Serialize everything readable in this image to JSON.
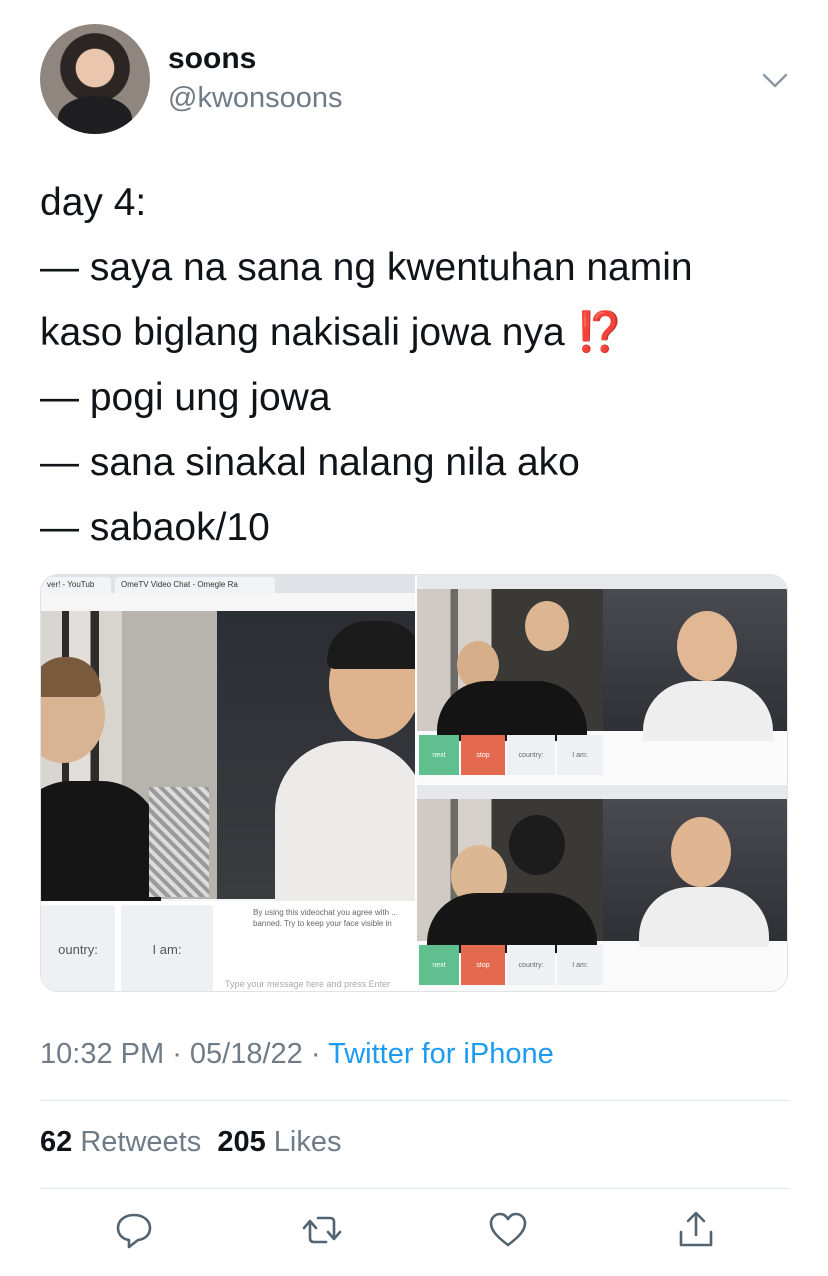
{
  "author": {
    "name": "soons",
    "handle": "@kwonsoons"
  },
  "tweet": {
    "lines": [
      "day 4:",
      "— saya na sana ng kwentuhan namin",
      "kaso biglang nakisali jowa nya",
      "— pogi ung jowa",
      "— sana sinakal nalang nila ako",
      "— sabaok/10"
    ],
    "emoji": "⁉️"
  },
  "media": {
    "left": {
      "tab1": "ver! - YouTub",
      "tab2": "OmeTV Video Chat - Omegle Ra",
      "country_label": "ountry:",
      "iam_label": "I am:",
      "terms": "By using this videochat you agree with ... banned. Try to keep your face visible in",
      "message_placeholder": "Type your message here and press Enter"
    },
    "right": {
      "next": "next",
      "stop": "stop",
      "country": "country:",
      "iam": "I am:"
    }
  },
  "meta": {
    "time": "10:32 PM",
    "date": "05/18/22",
    "source": "Twitter for iPhone"
  },
  "stats": {
    "retweets_count": "62",
    "retweets_label": "Retweets",
    "likes_count": "205",
    "likes_label": "Likes"
  },
  "icons": [
    "reply-icon",
    "retweet-icon",
    "like-icon",
    "share-icon"
  ],
  "colors": {
    "accent": "#1d9bf0",
    "secondary_text": "#6f7b86",
    "primary_text": "#0f1419",
    "alert": "#e0443e"
  }
}
